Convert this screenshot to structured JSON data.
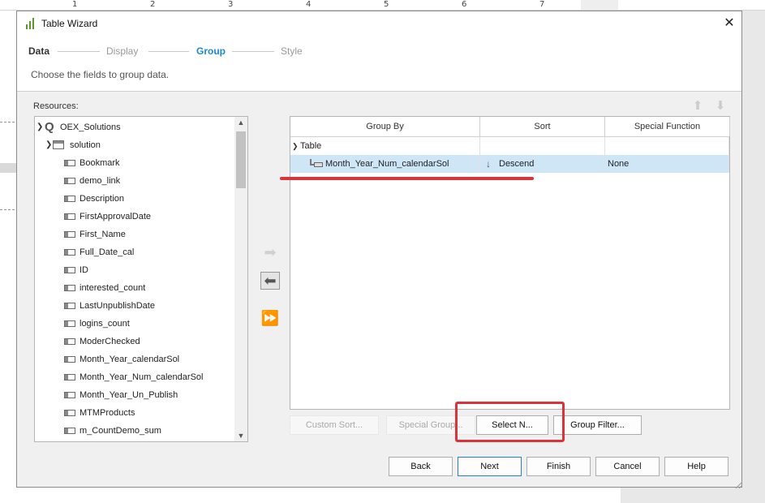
{
  "window": {
    "title": "Table Wizard",
    "close_glyph": "✕"
  },
  "ruler_numbers": [
    "1",
    "2",
    "3",
    "4",
    "5",
    "6",
    "7"
  ],
  "steps": [
    {
      "label": "Data",
      "state": "done"
    },
    {
      "label": "Display",
      "state": "pending"
    },
    {
      "label": "Group",
      "state": "active"
    },
    {
      "label": "Style",
      "state": "pending"
    }
  ],
  "subtitle": "Choose the fields to group data.",
  "resources": {
    "label": "Resources:",
    "source": "OEX_Solutions",
    "table": "solution",
    "fields": [
      "Bookmark",
      "demo_link",
      "Description",
      "FirstApprovalDate",
      "First_Name",
      "Full_Date_cal",
      "ID",
      "interested_count",
      "LastUnpublishDate",
      "logins_count",
      "ModerChecked",
      "Month_Year_calendarSol",
      "Month_Year_Num_calendarSol",
      "Month_Year_Un_Publish",
      "MTMProducts",
      "m_CountDemo_sum"
    ]
  },
  "transfer_buttons": {
    "add_icon": "arrow-right-icon",
    "remove_icon": "arrow-left-icon",
    "add_all_icon": "double-arrow-right-icon"
  },
  "group_grid": {
    "columns": [
      "Group By",
      "Sort",
      "Special Function"
    ],
    "group_node": "Table",
    "rows": [
      {
        "group_by": "Month_Year_Num_calendarSol",
        "sort_icon": "↓",
        "sort": "Descend",
        "special_function": "None"
      }
    ]
  },
  "action_buttons": {
    "custom_sort": "Custom Sort...",
    "special_group": "Special Group...",
    "select_n": "Select N...",
    "group_filter": "Group Filter..."
  },
  "footer_buttons": {
    "back": "Back",
    "next": "Next",
    "finish": "Finish",
    "cancel": "Cancel",
    "help": "Help"
  },
  "colors": {
    "active_step": "#1a8ad4",
    "selection": "#cfe6f7",
    "annotation": "#d9343a"
  }
}
